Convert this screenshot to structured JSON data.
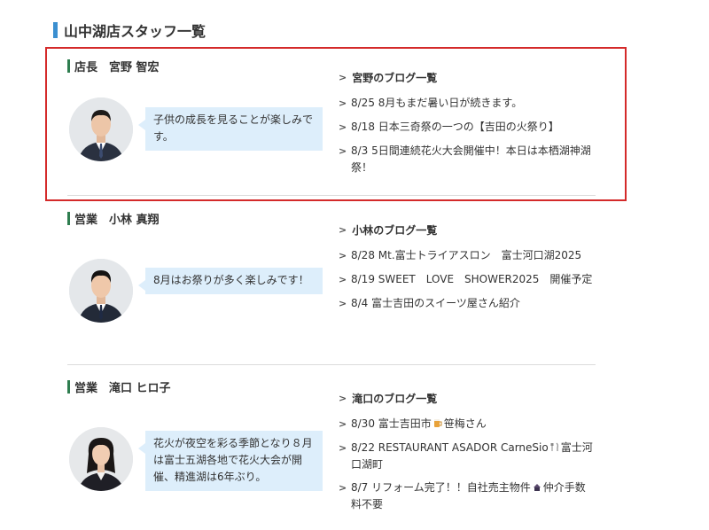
{
  "page": {
    "title": "山中湖店スタッフ一覧"
  },
  "staff": [
    {
      "name": "店長　宮野 智宏",
      "avatar_gender": "male",
      "message": "子供の成長を見ることが楽しみです。",
      "blog_title": "宮野のブログ一覧",
      "posts": [
        {
          "text": "8/25 8月もまだ暑い日が続きます。"
        },
        {
          "text": "8/18 日本三奇祭の一つの【吉田の火祭り】"
        },
        {
          "text": "8/3 5日間連続花火大会開催中！本日は本栖湖神湖祭！"
        }
      ]
    },
    {
      "name": "営業　小林 真翔",
      "avatar_gender": "male",
      "message": "8月はお祭りが多く楽しみです！",
      "blog_title": "小林のブログ一覧",
      "posts": [
        {
          "text": "8/28 Mt.富士トライアスロン　富士河口湖2025"
        },
        {
          "text": "8/19 SWEET　LOVE　SHOWER2025　開催予定"
        },
        {
          "text": "8/4 富士吉田のスイーツ屋さん紹介"
        }
      ]
    },
    {
      "name": "営業　滝口 ヒロ子",
      "avatar_gender": "female",
      "message": "花火が夜空を彩る季節となり８月は富士五湖各地で花火大会が開催、精進湖は6年ぶり。",
      "blog_title": "滝口のブログ一覧",
      "posts": [
        {
          "text_a": "8/30 富士吉田市",
          "icon_a": "beer-icon",
          "text_b": "笹梅さん"
        },
        {
          "text_a": "8/22 RESTAURANT ASADOR CarneSio",
          "icon_a": "fork-knife-icon",
          "text_b": "富士河口湖町"
        },
        {
          "text_a": "8/7 リフォーム完了！！自社売主物件",
          "icon_a": "house-icon",
          "text_b": "仲介手数料不要"
        }
      ]
    }
  ],
  "colors": {
    "title_bar": "#3b8fd0",
    "name_bar": "#2e7d4f",
    "bubble": "#ddeefb",
    "highlight": "#d42a2a"
  }
}
